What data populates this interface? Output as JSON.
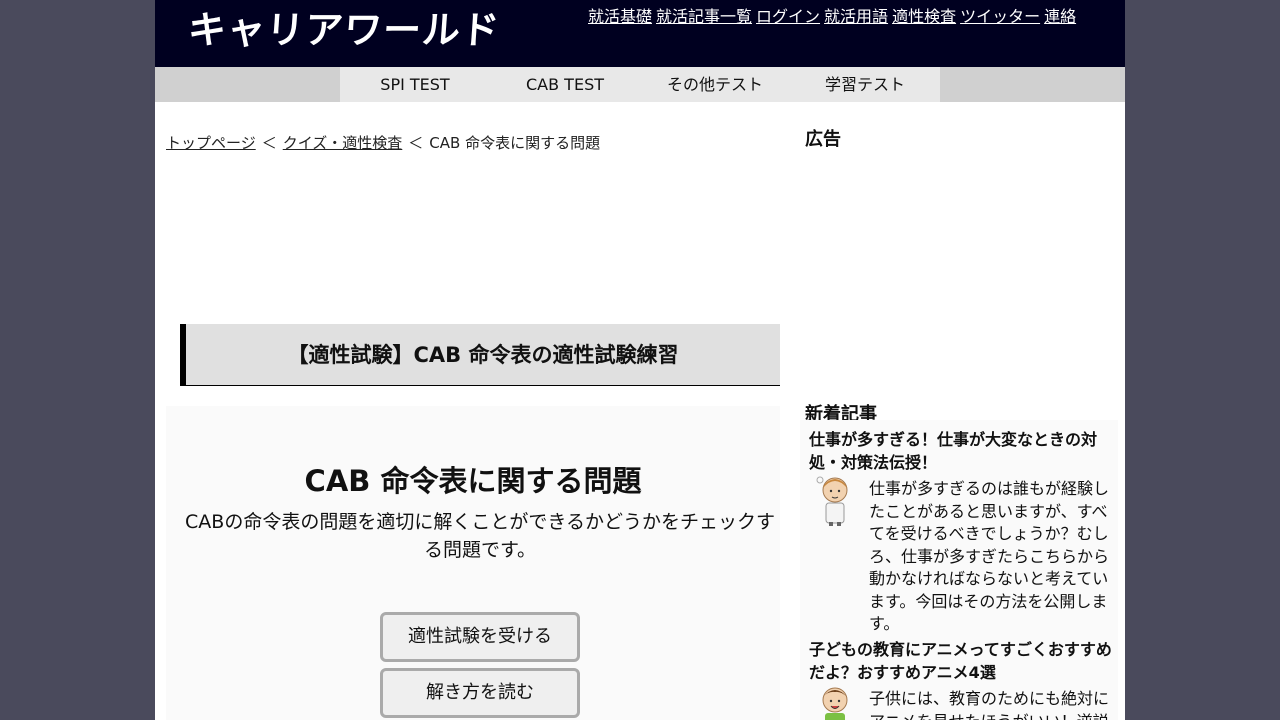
{
  "header": {
    "logo": "キャリアワールド",
    "links": [
      "就活基礎",
      "就活記事一覧",
      "ログイン",
      "就活用語",
      "適性検査",
      "ツイッター",
      "連絡"
    ]
  },
  "nav": {
    "items": [
      "SPI TEST",
      "CAB TEST",
      "その他テスト",
      "学習テスト"
    ]
  },
  "breadcrumb": {
    "home": "トップページ",
    "sep": "＜",
    "category": "クイズ・適性検査",
    "current": "CAB 命令表に関する問題"
  },
  "main": {
    "heading": "【適性試験】CAB 命令表の適性試験練習",
    "quiz_title": "CAB 命令表に関する問題",
    "quiz_desc": "CABの命令表の問題を適切に解くことができるかどうかをチェックする問題です。",
    "take_button": "適性試験を受ける",
    "read_button": "解き方を読む"
  },
  "sidebar": {
    "ad_label": "広告",
    "news_label": "新着記事",
    "articles": [
      {
        "title": "仕事が多すぎる！仕事が大変なときの対処・対策法伝授！",
        "body": "仕事が多すぎるのは誰もが経験したことがあると思いますが、すべてを受けるべきでしょうか？むしろ、仕事が多すぎたらこちらから動かなければならないと考えています。今回はその方法を公開します。"
      },
      {
        "title": "子どもの教育にアニメってすごくおすすめだよ？おすすめアニメ4選",
        "body": "子供には、教育のためにも絶対にアニメを見せたほうがいい！逆説"
      }
    ]
  }
}
